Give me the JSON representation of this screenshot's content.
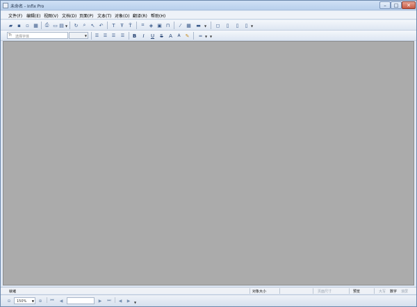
{
  "window": {
    "title": "未命名 - Infix Pro"
  },
  "menu": {
    "items": [
      {
        "label": "文件(F)"
      },
      {
        "label": "编辑(E)"
      },
      {
        "label": "视图(V)"
      },
      {
        "label": "文档(D)"
      },
      {
        "label": "页面(P)"
      },
      {
        "label": "文本(T)"
      },
      {
        "label": "对象(O)"
      },
      {
        "label": "翻译(R)"
      },
      {
        "label": "帮助(H)"
      }
    ]
  },
  "format_toolbar": {
    "font_icon_glyph": "Tt",
    "font_placeholder": "选择字体",
    "bold": "B",
    "italic": "I",
    "underline": "U",
    "strike": "S",
    "superscript": "A",
    "font_size_up": "A"
  },
  "status_bar": {
    "ready": "就绪",
    "object_size": "对象大小",
    "page_size": "页面尺寸",
    "preview": "预览",
    "caps": "大写",
    "num": "数字",
    "scroll": "滚屏"
  },
  "nav_bar": {
    "zoom_value": "150%"
  },
  "icons": {
    "toolbar1": [
      "open-folder-icon",
      "save-icon",
      "save-as-icon",
      "export-icon",
      "print-icon",
      "new-page-icon",
      "page-view-icon",
      "refresh-icon",
      "zoom-icon",
      "pointer-icon",
      "undo-icon",
      "text-tool-icon",
      "text-flow-icon",
      "text-edit-icon",
      "crop-icon",
      "shape-icon",
      "image-icon",
      "link-icon",
      "eyedropper-icon",
      "grid-icon",
      "color-icon",
      "note-icon",
      "export-page-icon",
      "page-add-icon",
      "page-doc-icon"
    ],
    "toolbar2": [
      "align-left-icon",
      "align-center-icon",
      "align-right-icon",
      "justify-icon",
      "marker-icon",
      "line-icon"
    ],
    "nav": [
      "first-page-icon",
      "prev-page-icon",
      "next-page-icon",
      "last-page-icon",
      "back-icon",
      "forward-icon"
    ]
  },
  "colors": {
    "workspace": "#ababab",
    "chrome": "#dfe8f4"
  }
}
